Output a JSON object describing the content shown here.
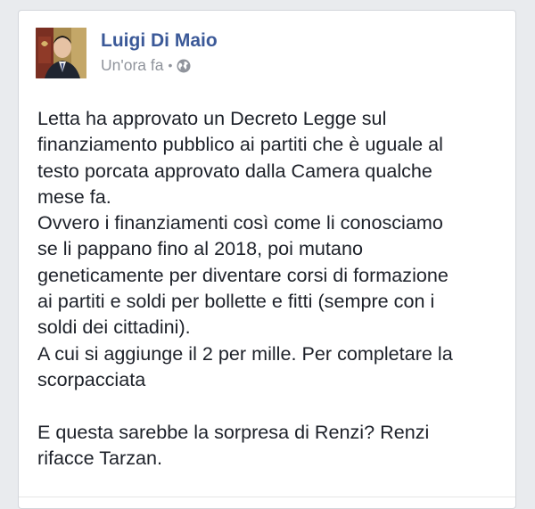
{
  "post": {
    "author": "Luigi Di Maio",
    "timestamp": "Un'ora fa",
    "separator": "•",
    "privacy_icon": "globe-icon",
    "lines": [
      "Letta ha approvato un Decreto Legge sul",
      "finanziamento pubblico ai partiti che è uguale al",
      "testo porcata approvato dalla Camera qualche",
      "mese fa.",
      "Ovvero i finanziamenti così come li conosciamo",
      "se li pappano fino al 2018, poi mutano",
      "geneticamente per diventare corsi di formazione",
      "ai partiti e soldi per bollette e fitti (sempre con i",
      "soldi dei cittadini).",
      "A cui si aggiunge il 2 per mille. Per completare la",
      "scorpacciata",
      "",
      "E questa sarebbe la sorpresa di Renzi? Renzi",
      "rifacce Tarzan."
    ]
  },
  "colors": {
    "page_background": "#e9ebee",
    "card_background": "#ffffff",
    "author_link": "#3b5998",
    "meta_text": "#90949c",
    "body_text": "#1d2129"
  }
}
